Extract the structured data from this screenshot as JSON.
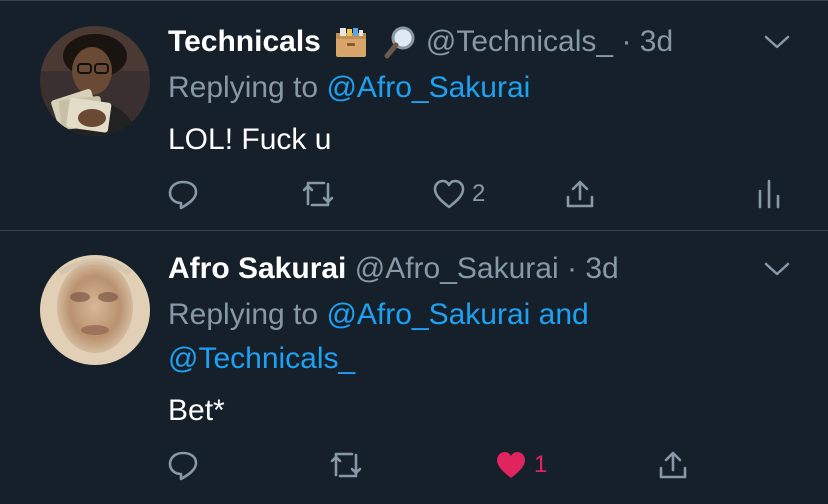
{
  "tweets": [
    {
      "display_name": "Technicals",
      "emojis": [
        "card-file-box-emoji",
        "magnifying-glass-emoji"
      ],
      "handle": "@Technicals_",
      "separator": "·",
      "time": "3d",
      "replying_prefix": "Replying to",
      "replying_to": "@Afro_Sakurai",
      "text": "LOL! Fuck u",
      "like_count": "2",
      "liked": false
    },
    {
      "display_name": "Afro Sakurai",
      "handle": "@Afro_Sakurai",
      "separator": "·",
      "time": "3d",
      "replying_prefix": "Replying to",
      "replying_to": "@Afro_Sakurai and @Technicals_",
      "text": "Bet*",
      "like_count": "1",
      "liked": true
    }
  ],
  "colors": {
    "background": "#15202b",
    "secondary_text": "#8899a6",
    "accent": "#1da1f2",
    "like": "#e0245e",
    "divider": "#38444d"
  }
}
